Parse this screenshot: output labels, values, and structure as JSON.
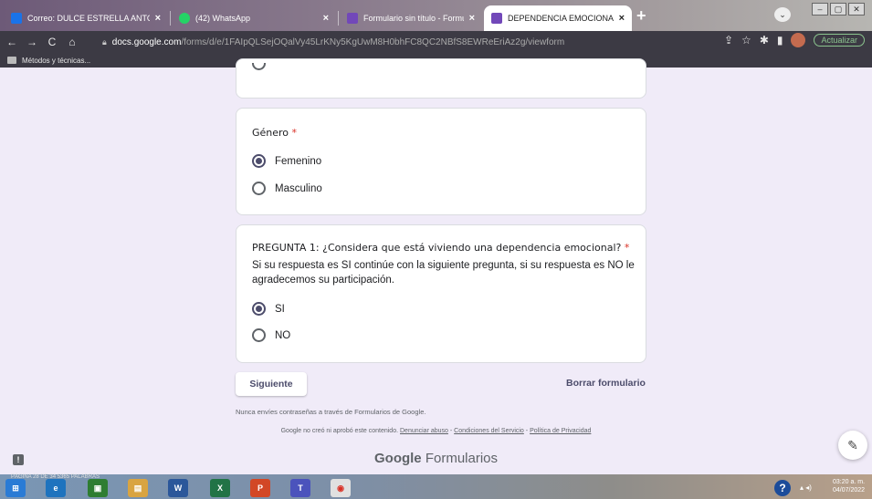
{
  "browser": {
    "tabs": [
      {
        "title": "Correo: DULCE ESTRELLA ANTON",
        "favicon_color": "#1a73e8"
      },
      {
        "title": "(42) WhatsApp",
        "favicon_color": "#25d366"
      },
      {
        "title": "Formulario sin título - Formulario",
        "favicon_color": "#7248b9"
      },
      {
        "title": "DEPENDENCIA EMOCIONAL EN",
        "favicon_color": "#7248b9"
      }
    ],
    "new_tab_label": "+",
    "url_host": "docs.google.com",
    "url_path": "/forms/d/e/1FAIpQLSejOQalVy45LrKNy5KgUwM8H0bhFC8QC2NBfS8EWReEriAz2g/viewform",
    "update_label": "Actualizar",
    "bookmark_folder": "Métodos y técnicas..."
  },
  "form": {
    "gender": {
      "title": "Género",
      "required_mark": "*",
      "options": [
        "Femenino",
        "Masculino"
      ],
      "selected": "Femenino"
    },
    "q1": {
      "title": "PREGUNTA 1: ¿Considera que está viviendo una dependencia emocional?",
      "required_mark": "*",
      "description": "Si su respuesta es SI continúe con la siguiente pregunta, si su respuesta es NO le agradecemos su participación.",
      "options": [
        "SI",
        "NO"
      ],
      "selected": "SI"
    },
    "next_button": "Siguiente",
    "clear_button": "Borrar formulario",
    "password_note": "Nunca envíes contraseñas a través de Formularios de Google.",
    "legal_prefix": "Google no creó ni aprobó este contenido.",
    "legal_links": [
      "Denunciar abuso",
      "Condiciones del Servicio",
      "Política de Privacidad"
    ],
    "brand_google": "Google",
    "brand_forms": "Formularios"
  },
  "taskbar": {
    "status": "PÁGINA 28 DE 34   5365 PALABRAS",
    "clock_time": "03:20 a. m.",
    "clock_date": "04/07/2022",
    "apps": [
      {
        "label": "e",
        "color": "#1e73be"
      },
      {
        "label": "▣",
        "color": "#2e7d32"
      },
      {
        "label": "▤",
        "color": "#d9a441"
      },
      {
        "label": "W",
        "color": "#2b579a"
      },
      {
        "label": "X",
        "color": "#217346"
      },
      {
        "label": "P",
        "color": "#d24726"
      },
      {
        "label": "T",
        "color": "#4b53bc"
      },
      {
        "label": "◉",
        "color": "#e0e0e0"
      }
    ]
  }
}
